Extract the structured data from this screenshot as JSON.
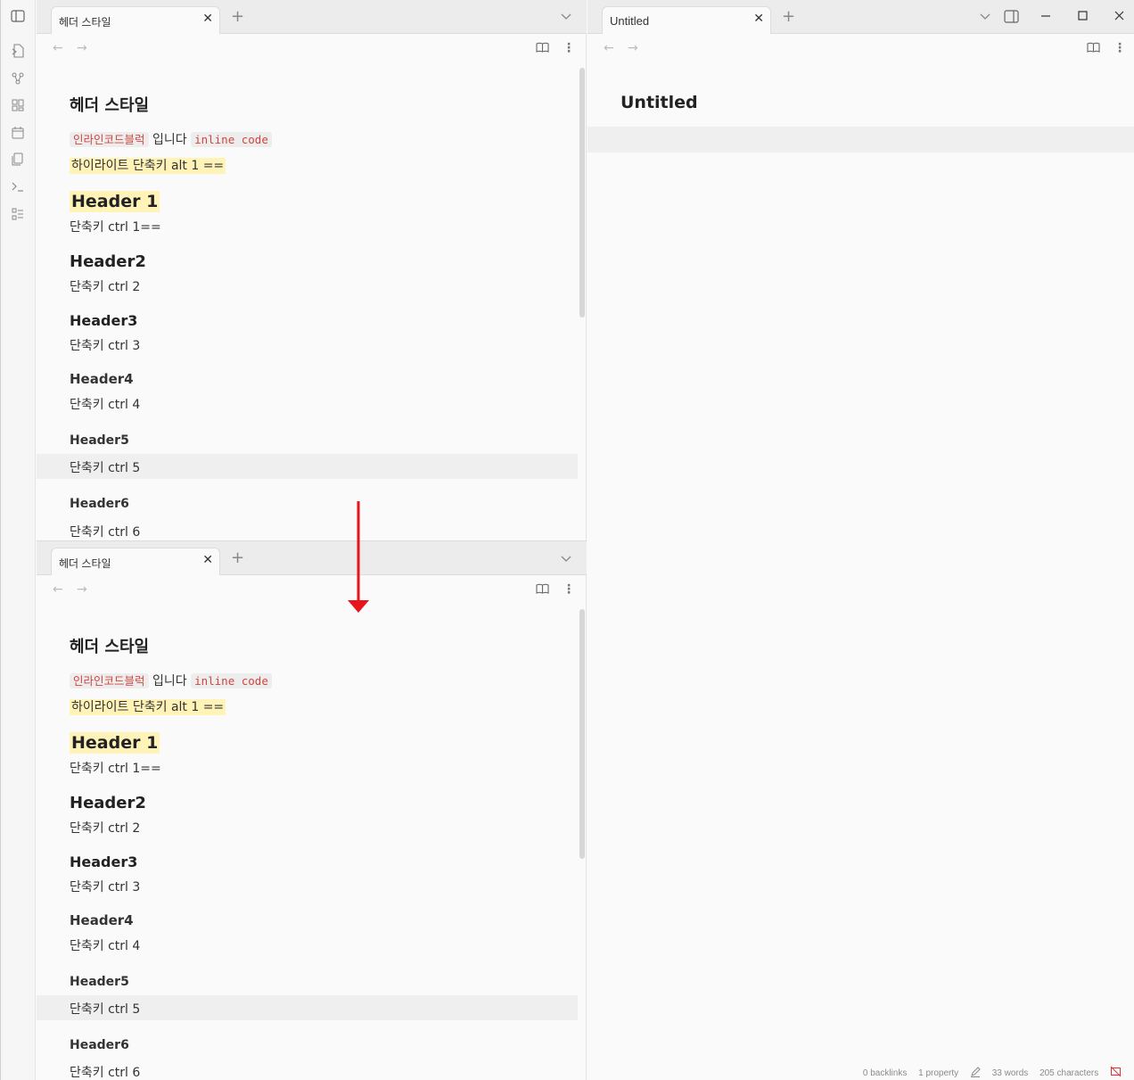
{
  "ribbon": {
    "icons": [
      "sidebar-toggle-icon",
      "open-quick-switcher-icon",
      "graph-view-icon",
      "canvas-icon",
      "daily-note-icon",
      "templates-icon",
      "command-palette-icon",
      "outline-icon"
    ]
  },
  "left_top_pane": {
    "tab_label": "헤더 스타일",
    "tab_close": "✕",
    "new_tab": "+",
    "note": {
      "title": "헤더 스타일",
      "code_block_label": "인라인코드블럭",
      "mid_text": " 입니다 ",
      "inline_code": "inline code",
      "highlight_text": "하이라이트 단축키 alt 1 ==",
      "header1": "Header 1",
      "header1_shortcut": "단축키 ctrl 1==",
      "header2": "Header2",
      "header2_shortcut": "단축키 ctrl 2",
      "header3": "Header3",
      "header3_shortcut": "단축키 ctrl 3",
      "header4": "Header4",
      "header4_shortcut": "단축키 ctrl 4",
      "header5": "Header5",
      "header5_shortcut": "단축키 ctrl 5",
      "header6": "Header6",
      "header6_shortcut": "단축키 ctrl 6"
    }
  },
  "left_bottom_pane": {
    "tab_label": "헤더 스타일",
    "tab_close": "✕",
    "new_tab": "+",
    "note": {
      "title": "헤더 스타일",
      "code_block_label": "인라인코드블럭",
      "mid_text": " 입니다 ",
      "inline_code": "inline code",
      "highlight_text": "하이라이트 단축키 alt 1 ==",
      "header1": "Header 1",
      "header1_shortcut": "단축키 ctrl 1==",
      "header2": "Header2",
      "header2_shortcut": "단축키 ctrl 2",
      "header3": "Header3",
      "header3_shortcut": "단축키 ctrl 3",
      "header4": "Header4",
      "header4_shortcut": "단축키 ctrl 4",
      "header5": "Header5",
      "header5_shortcut": "단축키 ctrl 5",
      "header6": "Header6",
      "header6_shortcut": "단축키 ctrl 6"
    }
  },
  "right_pane": {
    "tab_label": "Untitled",
    "tab_close": "✕",
    "new_tab": "+",
    "note_title": "Untitled"
  },
  "status_bar": {
    "backlinks": "0 backlinks",
    "properties": "1 property",
    "words": "33 words",
    "characters": "205 characters"
  },
  "annotation": {
    "arrow_color": "#e8141b"
  }
}
